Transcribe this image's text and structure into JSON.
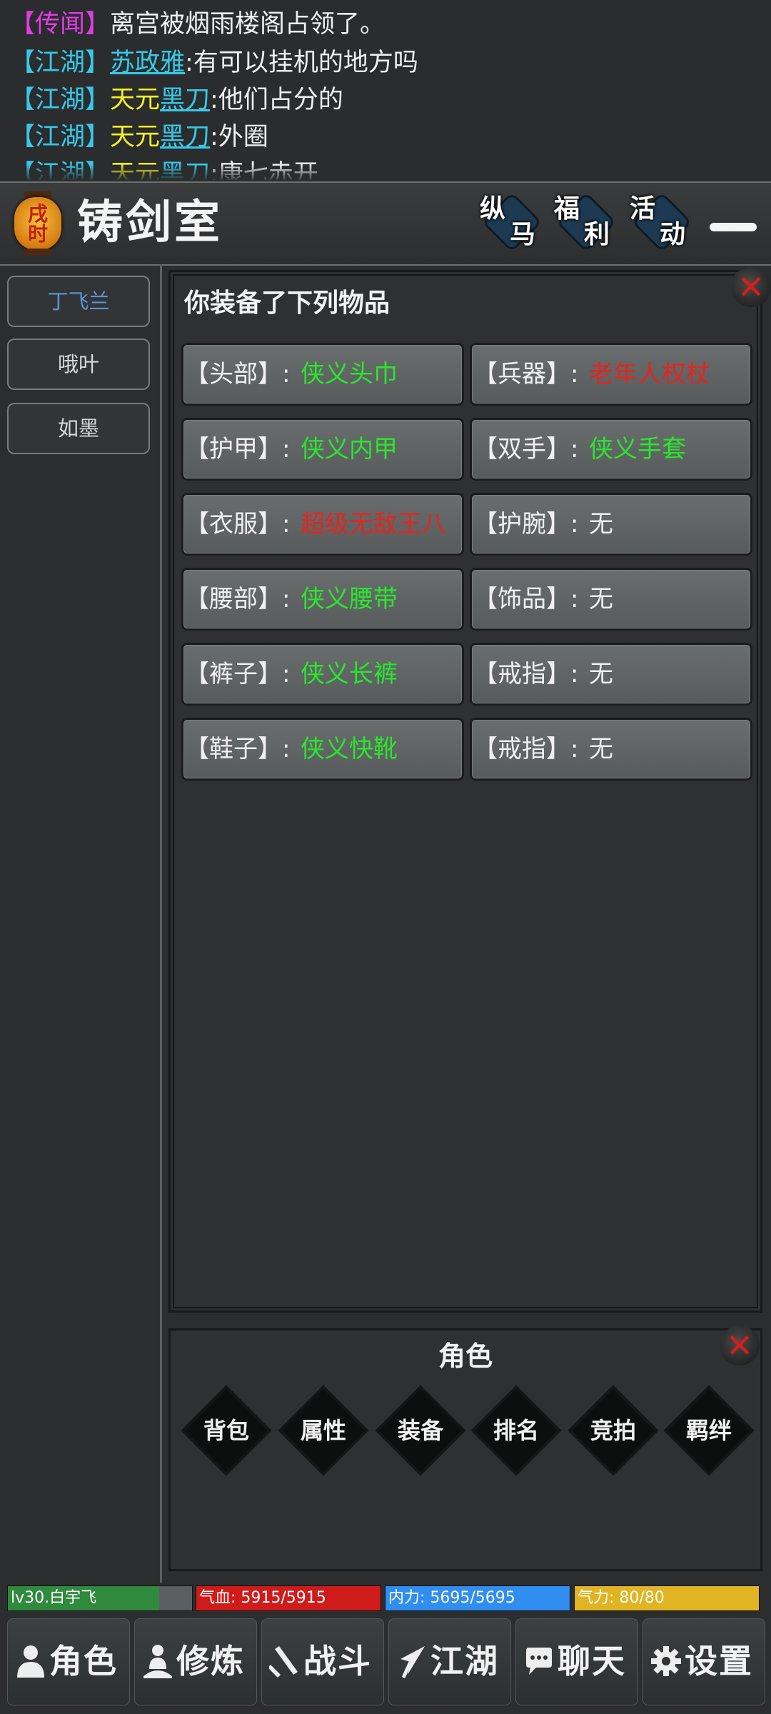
{
  "chat": {
    "lines": [
      {
        "channel": "【传闻】",
        "speaker": "",
        "speaker_highlight": "",
        "sep": "",
        "message": "离宫被烟雨楼阁占领了。"
      },
      {
        "channel": "【江湖】",
        "speaker": "",
        "speaker_highlight": "苏政雅",
        "sep": ":",
        "message": "有可以挂机的地方吗"
      },
      {
        "channel": "【江湖】",
        "speaker": "天元",
        "speaker_highlight": "黑刀",
        "sep": ":",
        "message": "他们占分的"
      },
      {
        "channel": "【江湖】",
        "speaker": "天元",
        "speaker_highlight": "黑刀",
        "sep": ":",
        "message": "外圈"
      },
      {
        "channel": "【江湖】",
        "speaker": "天元",
        "speaker_highlight": "黑刀",
        "sep": ":",
        "message": "康七赤开"
      }
    ]
  },
  "header": {
    "lantern_text_1": "戌",
    "lantern_text_2": "时",
    "title": "铸剑室",
    "buttons": [
      {
        "t1": "纵",
        "t2": "马"
      },
      {
        "t1": "福",
        "t2": "利"
      },
      {
        "t1": "活",
        "t2": "动"
      }
    ]
  },
  "characters": [
    "丁飞兰",
    "哦叶",
    "如墨"
  ],
  "equipment": {
    "title": "你装备了下列物品",
    "slots": [
      {
        "label": "【头部】:",
        "value": "侠义头巾",
        "color": "#27e82b"
      },
      {
        "label": "【兵器】:",
        "value": "老年人权杖",
        "color": "#e5251e"
      },
      {
        "label": "【护甲】:",
        "value": "侠义内甲",
        "color": "#27e82b"
      },
      {
        "label": "【双手】:",
        "value": "侠义手套",
        "color": "#27e82b"
      },
      {
        "label": "【衣服】:",
        "value": "超级无敌王八",
        "color": "#e5251e"
      },
      {
        "label": "【护腕】:",
        "value": "无",
        "color": "#f0f0f0"
      },
      {
        "label": "【腰部】:",
        "value": "侠义腰带",
        "color": "#27e82b"
      },
      {
        "label": "【饰品】:",
        "value": "无",
        "color": "#f0f0f0"
      },
      {
        "label": "【裤子】:",
        "value": "侠义长裤",
        "color": "#27e82b"
      },
      {
        "label": "【戒指】:",
        "value": "无",
        "color": "#f0f0f0"
      },
      {
        "label": "【鞋子】:",
        "value": "侠义快靴",
        "color": "#27e82b"
      },
      {
        "label": "【戒指】:",
        "value": "无",
        "color": "#f0f0f0"
      }
    ]
  },
  "role_panel": {
    "title": "角色",
    "buttons": [
      "背包",
      "属性",
      "装备",
      "排名",
      "竞拍",
      "羁绊"
    ]
  },
  "stats": {
    "level": "lv30.白宇飞",
    "level_progress": 0.82,
    "hp": "气血: 5915/5915",
    "hp_fraction": 1.0,
    "mp": "内力: 5695/5695",
    "mp_fraction": 1.0,
    "qi": "气力: 80/80",
    "qi_fraction": 1.0,
    "colors": {
      "level": "#2f8a3d",
      "hp": "#d01b1b",
      "mp": "#2f8ef0",
      "qi": "#e0b423"
    }
  },
  "nav": [
    {
      "label": "角色",
      "icon": "person-icon"
    },
    {
      "label": "修炼",
      "icon": "meditate-icon"
    },
    {
      "label": "战斗",
      "icon": "sword-icon"
    },
    {
      "label": "江湖",
      "icon": "arrow-icon"
    },
    {
      "label": "聊天",
      "icon": "chat-bubble-icon"
    },
    {
      "label": "设置",
      "icon": "gear-icon"
    }
  ]
}
